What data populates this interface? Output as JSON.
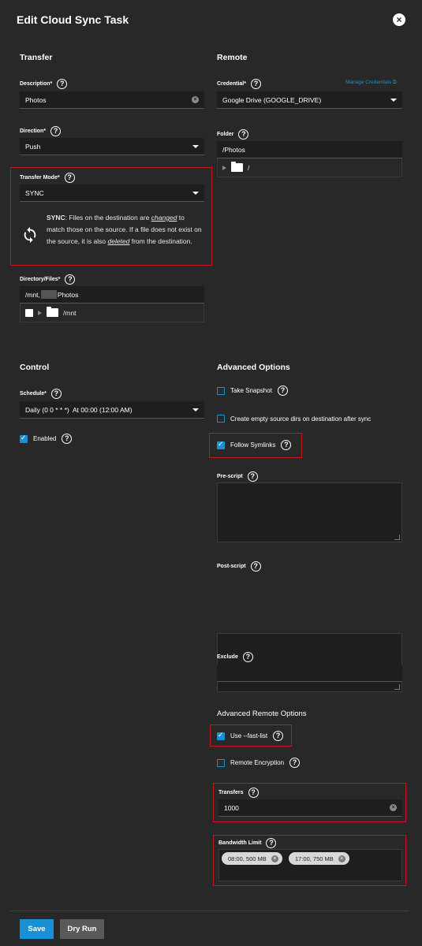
{
  "dialog": {
    "title": "Edit Cloud Sync Task",
    "close_icon": "×"
  },
  "transfer": {
    "section_title": "Transfer",
    "description": {
      "label": "Description",
      "required": "*",
      "value": "Photos"
    },
    "direction": {
      "label": "Direction",
      "required": "*",
      "value": "Push"
    },
    "transfer_mode": {
      "label": "Transfer Mode",
      "required": "*",
      "value": "SYNC",
      "help_prefix": "SYNC",
      "help_part1": ": Files on the destination are ",
      "help_em1": "changed",
      "help_part2": " to match those on the source. If a file does not exist on the source, it is also ",
      "help_em2": "deleted",
      "help_part3": " from the destination."
    },
    "directory_files": {
      "label": "Directory/Files",
      "required": "*",
      "value_prefix": "/mnt,",
      "value_suffix": "Photos",
      "tree_root": "/mnt"
    }
  },
  "remote": {
    "section_title": "Remote",
    "credential": {
      "label": "Credential",
      "required": "*",
      "value": "Google Drive (GOOGLE_DRIVE)",
      "manage_link": "Manage Credentials"
    },
    "folder": {
      "label": "Folder",
      "value": "/Photos",
      "tree_root": "/"
    }
  },
  "control": {
    "section_title": "Control",
    "schedule": {
      "label": "Schedule",
      "required": "*",
      "value": "Daily (0 0 * * *)  At 00:00 (12:00 AM)"
    },
    "enabled": {
      "label": "Enabled",
      "checked": true
    }
  },
  "advanced": {
    "section_title": "Advanced Options",
    "take_snapshot": {
      "label": "Take Snapshot",
      "checked": false
    },
    "create_empty_dirs": {
      "label": "Create empty source dirs on destination after sync",
      "checked": false
    },
    "follow_symlinks": {
      "label": "Follow Symlinks",
      "checked": true
    },
    "pre_script": {
      "label": "Pre-script",
      "value": ""
    },
    "post_script": {
      "label": "Post-script",
      "value": ""
    },
    "exclude": {
      "label": "Exclude",
      "value": ""
    }
  },
  "advanced_remote": {
    "section_title": "Advanced Remote Options",
    "fast_list": {
      "label": "Use --fast-list",
      "checked": true
    },
    "remote_encryption": {
      "label": "Remote Encryption",
      "checked": false
    },
    "transfers": {
      "label": "Transfers",
      "value": "1000"
    },
    "bandwidth_limit": {
      "label": "Bandwidth Limit",
      "chips": [
        "08:00, 500 MB",
        "17:00, 750 MB"
      ]
    }
  },
  "footer": {
    "save_label": "Save",
    "dry_run_label": "Dry Run"
  },
  "colors": {
    "background": "#282828",
    "accent": "#1a90d4",
    "highlight_border": "#c4161c",
    "field_bg": "#1e1e1e"
  }
}
